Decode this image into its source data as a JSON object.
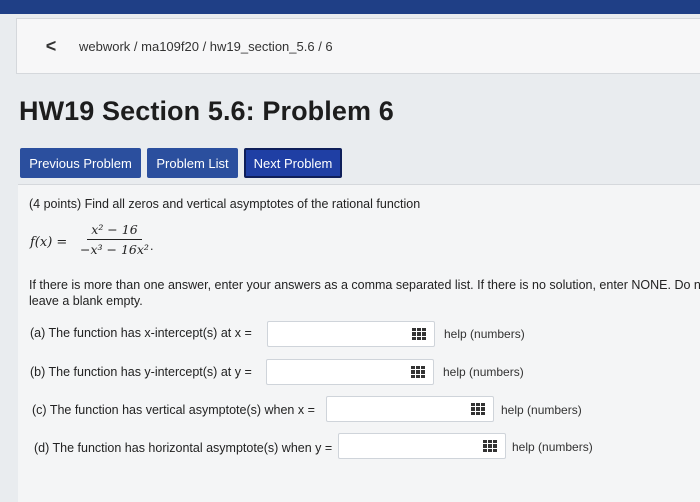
{
  "breadcrumb": {
    "back_symbol": "<",
    "path": "webwork / ma109f20 / hw19_section_5.6 / 6"
  },
  "page_title": "HW19 Section 5.6: Problem 6",
  "nav": {
    "previous": "Previous Problem",
    "list": "Problem List",
    "next": "Next Problem"
  },
  "problem": {
    "intro": "(4 points) Find all zeros and vertical asymptotes of the rational function",
    "function_lhs": "f(x) =",
    "numerator": "x² − 16",
    "denominator": "−x³ − 16x²",
    "period": ".",
    "instructions_line1": "If there is more than one answer, enter your answers as a comma separated list. If there is no solution, enter NONE. Do not",
    "instructions_line2": "leave a blank empty.",
    "parts": [
      {
        "label": "(a) The function has x-intercept(s) at x =",
        "value": "",
        "help": "help (numbers)"
      },
      {
        "label": "(b) The function has y-intercept(s) at y =",
        "value": "",
        "help": "help (numbers)"
      },
      {
        "label": "(c) The function has vertical asymptote(s) when x =",
        "value": "",
        "help": "help (numbers)"
      },
      {
        "label": "(d) The function has horizontal asymptote(s) when y =",
        "value": "",
        "help": "help (numbers)"
      }
    ]
  },
  "colors": {
    "top_bar": "#1f3f86",
    "button": "#2b4f9e",
    "page_bg": "#e9ecef"
  },
  "icons": {
    "back": "chevron-left-icon",
    "answer_grid": "grid-icon"
  }
}
